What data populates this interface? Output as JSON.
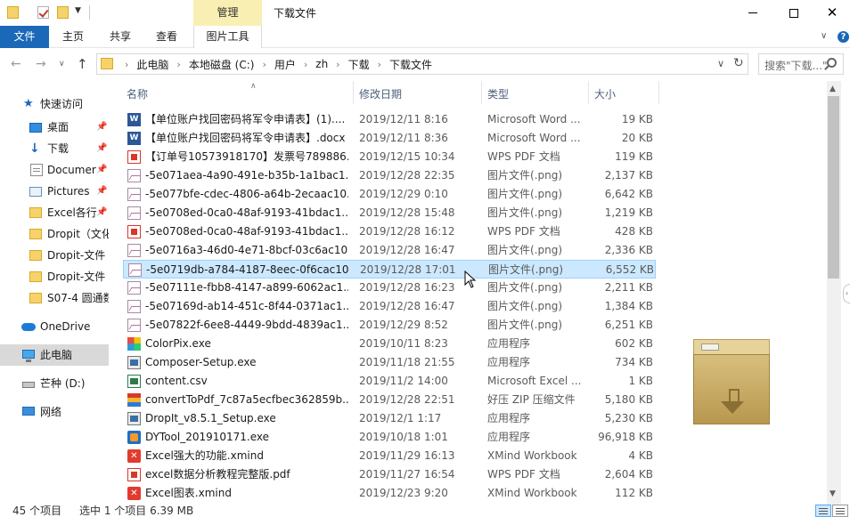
{
  "window": {
    "title": "下载文件",
    "manage_tab": "管理"
  },
  "ribbon": {
    "file": "文件",
    "home": "主页",
    "share": "共享",
    "view": "查看",
    "picture_tools": "图片工具"
  },
  "address": {
    "crumbs": [
      "此电脑",
      "本地磁盘 (C:)",
      "用户",
      "zh",
      "下载",
      "下载文件"
    ],
    "search_placeholder": "搜索\"下载...\""
  },
  "sidebar": {
    "items": [
      {
        "label": "快速访问",
        "icon": "star-icon"
      },
      {
        "label": "桌面",
        "icon": "desktop-icon",
        "pinned": true
      },
      {
        "label": "下载",
        "icon": "download-icon",
        "pinned": true
      },
      {
        "label": "Documer",
        "icon": "documents-icon",
        "pinned": true
      },
      {
        "label": "Pictures",
        "icon": "pictures-icon",
        "pinned": true
      },
      {
        "label": "Excel各行",
        "icon": "folder-icon",
        "pinned": true
      },
      {
        "label": "Dropit（文化",
        "icon": "folder-icon"
      },
      {
        "label": "Dropit-文件",
        "icon": "folder-icon"
      },
      {
        "label": "Dropit-文件",
        "icon": "folder-icon"
      },
      {
        "label": "S07-4 圆通数",
        "icon": "folder-icon"
      },
      {
        "label": "OneDrive",
        "icon": "onedrive-icon"
      },
      {
        "label": "此电脑",
        "icon": "this-pc-icon",
        "selected": true
      },
      {
        "label": "芒种 (D:)",
        "icon": "drive-icon"
      },
      {
        "label": "网络",
        "icon": "network-icon"
      }
    ]
  },
  "columns": {
    "name": "名称",
    "date": "修改日期",
    "type": "类型",
    "size": "大小"
  },
  "files": [
    {
      "name": "【单位账户找回密码将军令申请表】(1)....",
      "date": "2019/12/11 8:16",
      "type": "Microsoft Word ...",
      "size": "19 KB",
      "icon": "word"
    },
    {
      "name": "【单位账户找回密码将军令申请表】.docx",
      "date": "2019/12/11 8:36",
      "type": "Microsoft Word ...",
      "size": "20 KB",
      "icon": "word"
    },
    {
      "name": "【订单号10573918170】发票号789886...",
      "date": "2019/12/15 10:34",
      "type": "WPS PDF 文档",
      "size": "119 KB",
      "icon": "pdf"
    },
    {
      "name": "-5e071aea-4a90-491e-b35b-1a1bac1...",
      "date": "2019/12/28 22:35",
      "type": "图片文件(.png)",
      "size": "2,137 KB",
      "icon": "png"
    },
    {
      "name": "-5e077bfe-cdec-4806-a64b-2ecaac10...",
      "date": "2019/12/29 0:10",
      "type": "图片文件(.png)",
      "size": "6,642 KB",
      "icon": "png"
    },
    {
      "name": "-5e0708ed-0ca0-48af-9193-41bdac1...",
      "date": "2019/12/28 15:48",
      "type": "图片文件(.png)",
      "size": "1,219 KB",
      "icon": "png"
    },
    {
      "name": "-5e0708ed-0ca0-48af-9193-41bdac1...",
      "date": "2019/12/28 16:12",
      "type": "WPS PDF 文档",
      "size": "428 KB",
      "icon": "pdf"
    },
    {
      "name": "-5e0716a3-46d0-4e71-8bcf-03c6ac10...",
      "date": "2019/12/28 16:47",
      "type": "图片文件(.png)",
      "size": "2,336 KB",
      "icon": "png"
    },
    {
      "name": "-5e0719db-a784-4187-8eec-0f6cac10...",
      "date": "2019/12/28 17:01",
      "type": "图片文件(.png)",
      "size": "6,552 KB",
      "icon": "png",
      "selected": true
    },
    {
      "name": "-5e07111e-fbb8-4147-a899-6062ac1...",
      "date": "2019/12/28 16:23",
      "type": "图片文件(.png)",
      "size": "2,211 KB",
      "icon": "png"
    },
    {
      "name": "-5e07169d-ab14-451c-8f44-0371ac1...",
      "date": "2019/12/28 16:47",
      "type": "图片文件(.png)",
      "size": "1,384 KB",
      "icon": "png"
    },
    {
      "name": "-5e07822f-6ee8-4449-9bdd-4839ac1...",
      "date": "2019/12/29 8:52",
      "type": "图片文件(.png)",
      "size": "6,251 KB",
      "icon": "png"
    },
    {
      "name": "ColorPix.exe",
      "date": "2019/10/11 8:23",
      "type": "应用程序",
      "size": "602 KB",
      "icon": "colorpix"
    },
    {
      "name": "Composer-Setup.exe",
      "date": "2019/11/18 21:55",
      "type": "应用程序",
      "size": "734 KB",
      "icon": "exe"
    },
    {
      "name": "content.csv",
      "date": "2019/11/2 14:00",
      "type": "Microsoft Excel ...",
      "size": "1 KB",
      "icon": "csv"
    },
    {
      "name": "convertToPdf_7c87a5ecfbec362859b...",
      "date": "2019/12/28 22:51",
      "type": "好压 ZIP 压缩文件",
      "size": "5,180 KB",
      "icon": "zip"
    },
    {
      "name": "DropIt_v8.5.1_Setup.exe",
      "date": "2019/12/1 1:17",
      "type": "应用程序",
      "size": "5,230 KB",
      "icon": "exe"
    },
    {
      "name": "DYTool_201910171.exe",
      "date": "2019/10/18 1:01",
      "type": "应用程序",
      "size": "96,918 KB",
      "icon": "dytool"
    },
    {
      "name": "Excel强大的功能.xmind",
      "date": "2019/11/29 16:13",
      "type": "XMind Workbook",
      "size": "4 KB",
      "icon": "xmind"
    },
    {
      "name": "excel数据分析教程完整版.pdf",
      "date": "2019/11/27 16:54",
      "type": "WPS PDF 文档",
      "size": "2,604 KB",
      "icon": "pdf"
    },
    {
      "name": "Excel图表.xmind",
      "date": "2019/12/23 9:20",
      "type": "XMind Workbook",
      "size": "112 KB",
      "icon": "xmind"
    }
  ],
  "status": {
    "count": "45 个项目",
    "selection": "选中 1 个项目 6.39 MB"
  }
}
